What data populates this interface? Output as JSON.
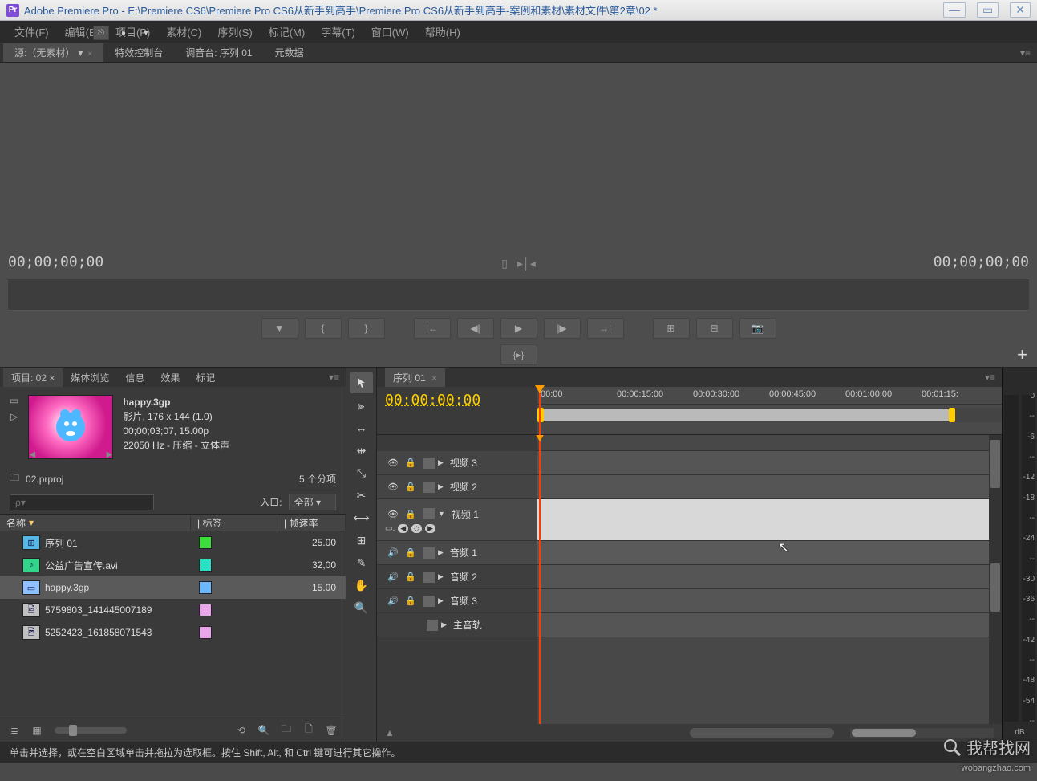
{
  "window": {
    "app_badge": "Pr",
    "title": "Adobe Premiere Pro - E:\\Premiere CS6\\Premiere Pro CS6从新手到高手\\Premiere Pro CS6从新手到高手-案例和素材\\素材文件\\第2章\\02 *"
  },
  "menubar": [
    "文件(F)",
    "编辑(E)",
    "项目(P)",
    "素材(C)",
    "序列(S)",
    "标记(M)",
    "字幕(T)",
    "窗口(W)",
    "帮助(H)"
  ],
  "source_tabs": {
    "source": "源:（无素材）",
    "effects": "特效控制台",
    "mixer": "调音台: 序列 01",
    "metadata": "元数据"
  },
  "monitor": {
    "tc_left": "00;00;00;00",
    "tc_right": "00;00;00;00"
  },
  "project": {
    "tabs": {
      "project": "项目: 02",
      "media": "媒体浏览",
      "info": "信息",
      "effects": "效果",
      "markers": "标记"
    },
    "clip": {
      "name": "happy.3gp",
      "line1": "影片, 176 x 144 (1.0)",
      "line2": "00;00;03;07, 15.00p",
      "line3": "22050 Hz - 压缩 - 立体声"
    },
    "file": "02.prproj",
    "count": "5 个分项",
    "search_placeholder": "ρ▾",
    "in_label": "入口:",
    "in_select": "全部",
    "columns": {
      "name": "名称",
      "label": "标签",
      "framerate": "帧速率"
    },
    "rows": [
      {
        "name": "序列 01",
        "color": "#3bdc3b",
        "framerate": "25.00",
        "icon": "sequence"
      },
      {
        "name": "公益广告宣传.avi",
        "color": "#2be0c4",
        "framerate": "32,00",
        "icon": "audioclip"
      },
      {
        "name": "happy.3gp",
        "color": "#6bb8ff",
        "framerate": "15.00",
        "icon": "movieclip",
        "selected": true
      },
      {
        "name": "5759803_141445007189",
        "color": "#e9a6e9",
        "framerate": "",
        "icon": "image"
      },
      {
        "name": "5252423_161858071543",
        "color": "#e9a6e9",
        "framerate": "",
        "icon": "image"
      }
    ]
  },
  "timeline": {
    "tab": "序列 01",
    "current_time": "00:00:00:00",
    "ruler": [
      "00:00",
      "00:00:15:00",
      "00:00:30:00",
      "00:00:45:00",
      "00:01:00:00",
      "00:01:15:"
    ],
    "tracks": {
      "v3": "视频 3",
      "v2": "视频 2",
      "v1": "视频 1",
      "a1": "音频 1",
      "a2": "音频 2",
      "a3": "音频 3",
      "master": "主音轨"
    }
  },
  "meters": {
    "levels": [
      "0",
      "--",
      "-6",
      "--",
      "-12",
      "-18",
      "--",
      "-24",
      "--",
      "-30",
      "-36",
      "--",
      "-42",
      "--",
      "-48",
      "-54",
      "--"
    ],
    "unit": "dB"
  },
  "status": "单击并选择，或在空白区域单击并拖拉为选取框。按住 Shift, Alt, 和 Ctrl 键可进行其它操作。",
  "watermark": {
    "text": "我帮找网",
    "sub": "wobangzhao.com"
  }
}
